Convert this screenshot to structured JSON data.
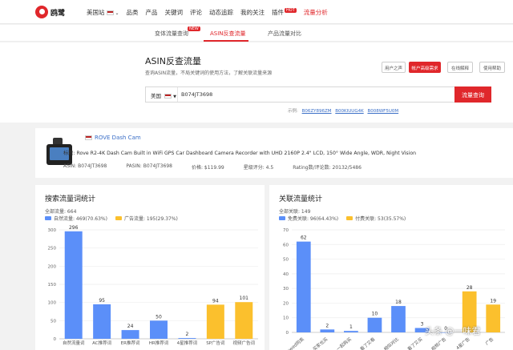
{
  "topbar": {
    "brand": "鸥鹭",
    "nav": [
      {
        "label": "美国站",
        "flag": true,
        "chevron": true
      },
      {
        "label": "品类"
      },
      {
        "label": "产品"
      },
      {
        "label": "关键词"
      },
      {
        "label": "评论"
      },
      {
        "label": "动态追踪"
      },
      {
        "label": "我的关注"
      },
      {
        "label": "插件",
        "badge": "HOT"
      },
      {
        "label": "流量分析",
        "active": true
      }
    ]
  },
  "subtabs": [
    {
      "label": "变体流量查询",
      "badge": "NEW"
    },
    {
      "label": "ASIN反查流量",
      "active": true
    },
    {
      "label": "产品流量对比"
    }
  ],
  "main": {
    "title": "ASIN反查流量",
    "description": "查询ASIN流量，不局关键词的使用方法，了解关联流量来源",
    "actions": [
      "用户之声",
      "帐户高级需求",
      "在线解释",
      "使用帮助"
    ],
    "country": "美国",
    "asin_value": "B074JT3698",
    "search_button": "流量查询",
    "examples_label": "示例:",
    "examples": [
      "B06ZY896ZM",
      "B00KIUUG4K",
      "B008WF5U0M"
    ]
  },
  "product": {
    "brand": "ROVE Dash Cam",
    "title_label": "标题:",
    "title": "Rove R2-4K Dash Cam Built in WiFi GPS Car Dashboard Camera Recorder with UHD 2160P 2.4\" LCD, 150° Wide Angle, WDR, Night Vision",
    "meta": [
      "ASIN: B074JT3698",
      "PASIN: B074JT3698",
      "价格: $119.99",
      "星级评分: 4.5",
      "Rating数/评论数: 20132/5486"
    ]
  },
  "left_card": {
    "title": "搜索流量词统计",
    "total": "全部流量: 664",
    "legend": [
      "自然流量: 469(70.63%)",
      "广告流量: 195(29.37%)"
    ]
  },
  "right_card": {
    "title": "关联流量统计",
    "total": "全部关联: 149",
    "legend": [
      "免费关联: 96(64.43%)",
      "付费关联: 53(35.57%)"
    ]
  },
  "watermark": "头条 @一味君",
  "colors": {
    "accent": "#e0272b",
    "blue": "#5b8ff9",
    "yellow": "#fbc02d"
  },
  "chart_data": [
    {
      "type": "bar",
      "title": "搜索流量词统计",
      "categories": [
        "自然流量词",
        "AC推荐词",
        "ER推荐词",
        "HR推荐词",
        "4星推荐词",
        "SP广告词",
        "视频广告词"
      ],
      "values": [
        296,
        95,
        24,
        50,
        2,
        94,
        101
      ],
      "bar_colors": [
        "blue",
        "blue",
        "blue",
        "blue",
        "blue",
        "yellow",
        "yellow"
      ],
      "yticks": [
        0,
        50,
        100,
        150,
        200,
        250,
        300
      ],
      "ylim": [
        0,
        300
      ],
      "grid": true
    },
    {
      "type": "bar",
      "title": "关联流量统计",
      "categories": [
        "viewed同类",
        "买家也买",
        "一起购买",
        "看了又看",
        "相似对比",
        "看了又买",
        "视频广告",
        "4星广告",
        "广告"
      ],
      "values": [
        62,
        2,
        1,
        10,
        18,
        3,
        0,
        28,
        19
      ],
      "bar_colors": [
        "blue",
        "blue",
        "blue",
        "blue",
        "blue",
        "blue",
        "blue",
        "yellow",
        "yellow"
      ],
      "yticks": [
        0,
        10,
        20,
        30,
        40,
        50,
        60,
        70
      ],
      "ylim": [
        0,
        70
      ],
      "grid": true
    }
  ]
}
